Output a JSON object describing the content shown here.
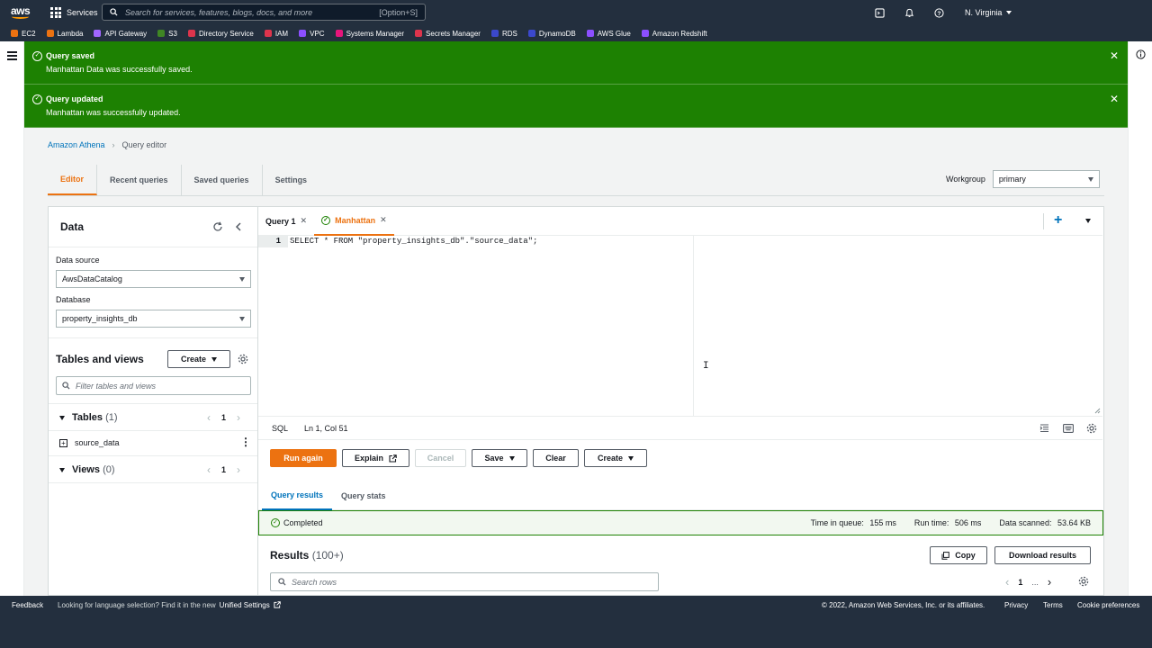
{
  "topbar": {
    "logo": "aws",
    "services": "Services",
    "search_placeholder": "Search for services, features, blogs, docs, and more",
    "search_shortcut": "[Option+S]",
    "region": "N. Virginia"
  },
  "favorites": [
    {
      "label": "EC2",
      "color": "#ec7211"
    },
    {
      "label": "Lambda",
      "color": "#ec7211"
    },
    {
      "label": "API Gateway",
      "color": "#a166ff"
    },
    {
      "label": "S3",
      "color": "#3f8624"
    },
    {
      "label": "Directory Service",
      "color": "#dd344c"
    },
    {
      "label": "IAM",
      "color": "#dd344c"
    },
    {
      "label": "VPC",
      "color": "#8c4fff"
    },
    {
      "label": "Systems Manager",
      "color": "#e7157b"
    },
    {
      "label": "Secrets Manager",
      "color": "#dd344c"
    },
    {
      "label": "RDS",
      "color": "#3b48cc"
    },
    {
      "label": "DynamoDB",
      "color": "#3b48cc"
    },
    {
      "label": "AWS Glue",
      "color": "#8c4fff"
    },
    {
      "label": "Amazon Redshift",
      "color": "#8c4fff"
    }
  ],
  "flash": [
    {
      "title": "Query saved",
      "message": "Manhattan Data was successfully saved."
    },
    {
      "title": "Query updated",
      "message": "Manhattan was successfully updated."
    }
  ],
  "breadcrumb": {
    "root": "Amazon Athena",
    "current": "Query editor"
  },
  "tabs": [
    "Editor",
    "Recent queries",
    "Saved queries",
    "Settings"
  ],
  "workgroup": {
    "label": "Workgroup",
    "value": "primary"
  },
  "data_panel": {
    "title": "Data",
    "data_source_label": "Data source",
    "data_source_value": "AwsDataCatalog",
    "database_label": "Database",
    "database_value": "property_insights_db",
    "tables_views_title": "Tables and views",
    "create_label": "Create",
    "filter_placeholder": "Filter tables and views",
    "tables_label": "Tables",
    "tables_count": "(1)",
    "tables_page": "1",
    "table_item": "source_data",
    "views_label": "Views",
    "views_count": "(0)",
    "views_page": "1"
  },
  "editor": {
    "tabs": [
      {
        "label": "Query 1"
      },
      {
        "label": "Manhattan"
      }
    ],
    "line_number": "1",
    "code": "SELECT * FROM \"property_insights_db\".\"source_data\";",
    "language": "SQL",
    "position": "Ln 1, Col 51"
  },
  "actions": {
    "run": "Run again",
    "explain": "Explain",
    "cancel": "Cancel",
    "save": "Save",
    "clear": "Clear",
    "create": "Create"
  },
  "results_tabs": [
    "Query results",
    "Query stats"
  ],
  "status": {
    "state": "Completed",
    "queue_label": "Time in queue:",
    "queue_value": "155 ms",
    "run_label": "Run time:",
    "run_value": "506 ms",
    "scanned_label": "Data scanned:",
    "scanned_value": "53.64 KB"
  },
  "results": {
    "title": "Results",
    "count": "(100+)",
    "copy": "Copy",
    "download": "Download results",
    "search_placeholder": "Search rows",
    "page": "1",
    "ellipsis": "..."
  },
  "footer": {
    "feedback": "Feedback",
    "lang_text": "Looking for language selection? Find it in the new",
    "unified": "Unified Settings",
    "copyright": "© 2022, Amazon Web Services, Inc. or its affiliates.",
    "privacy": "Privacy",
    "terms": "Terms",
    "cookie": "Cookie preferences"
  }
}
